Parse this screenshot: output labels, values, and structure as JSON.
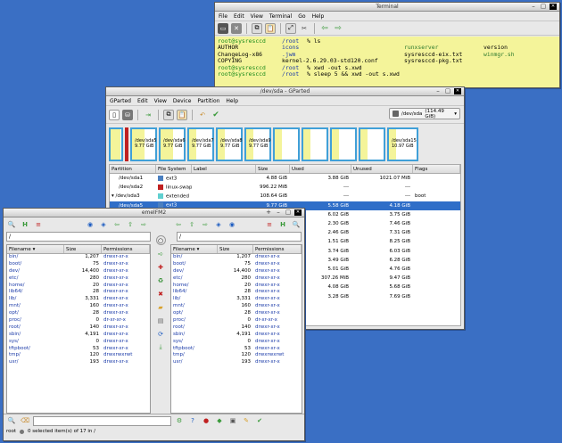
{
  "terminal": {
    "title": "Terminal",
    "menu": [
      "File",
      "Edit",
      "View",
      "Terminal",
      "Go",
      "Help"
    ],
    "lines": [
      {
        "prompt": "root@sysresccd",
        "path": "/root",
        "cmd": "% ls"
      },
      {
        "cols": [
          {
            "t": "AUTHOR",
            "c": ""
          },
          {
            "t": "icons",
            "c": "blue"
          },
          {
            "t": "runxserver",
            "c": "dkgreen"
          },
          {
            "t": "version",
            "c": ""
          }
        ]
      },
      {
        "cols": [
          {
            "t": "ChangeLog-x86",
            "c": ""
          },
          {
            "t": ".jwm",
            "c": "blue"
          },
          {
            "t": "sysresccd-eix.txt",
            "c": ""
          },
          {
            "t": "winmgr.sh",
            "c": "dkgreen"
          }
        ]
      },
      {
        "cols": [
          {
            "t": "COPYING",
            "c": ""
          },
          {
            "t": "kernel-2.6.29.03-std120.conf",
            "c": ""
          },
          {
            "t": "sysresccd-pkg.txt",
            "c": ""
          },
          {
            "t": "",
            "c": ""
          }
        ]
      },
      {
        "prompt": "root@sysresccd",
        "path": "/root",
        "cmd": "% xwd -out s.xwd"
      },
      {
        "prompt": "root@sysresccd",
        "path": "/root",
        "cmd": "% sleep 5 && xwd -out s.xwd"
      }
    ]
  },
  "gparted": {
    "title": "/dev/sda - GParted",
    "menu": [
      "GParted",
      "Edit",
      "View",
      "Device",
      "Partition",
      "Help"
    ],
    "device": "/dev/sda",
    "device_size": "(114.49 GiB)",
    "map": [
      {
        "name": "",
        "size": "",
        "fill": 0.95,
        "w": 16,
        "border": "#40a0d8"
      },
      {
        "name": "",
        "size": "",
        "fill": 0,
        "w": 4,
        "border": "#c02020"
      },
      {
        "name": "/dev/sda5",
        "size": "9.77 GiB",
        "fill": 0.55,
        "w": 30,
        "border": "#40a0d8"
      },
      {
        "name": "/dev/sda6",
        "size": "9.77 GiB",
        "fill": 0.55,
        "w": 30,
        "border": "#40a0d8"
      },
      {
        "name": "/dev/sda7",
        "size": "9.77 GiB",
        "fill": 0.3,
        "w": 30,
        "border": "#40a0d8"
      },
      {
        "name": "/dev/sda8",
        "size": "9.77 GiB",
        "fill": 0.3,
        "w": 30,
        "border": "#40a0d8"
      },
      {
        "name": "/dev/sda9",
        "size": "9.77 GiB",
        "fill": 0.3,
        "w": 30,
        "border": "#40a0d8"
      },
      {
        "name": "",
        "size": "",
        "fill": 0.3,
        "w": 30,
        "border": "#40a0d8"
      },
      {
        "name": "",
        "size": "",
        "fill": 0.3,
        "w": 30,
        "border": "#40a0d8"
      },
      {
        "name": "",
        "size": "",
        "fill": 0.3,
        "w": 30,
        "border": "#40a0d8"
      },
      {
        "name": "",
        "size": "",
        "fill": 0.3,
        "w": 30,
        "border": "#40a0d8"
      },
      {
        "name": "/dev/sda15",
        "size": "10.97 GiB",
        "fill": 0.25,
        "w": 35,
        "border": "#40a0d8"
      }
    ],
    "columns": [
      "Partition",
      "File System",
      "Label",
      "Size",
      "Used",
      "Unused",
      "Flags"
    ],
    "rows": [
      {
        "part": "/dev/sda1",
        "fs": "ext3",
        "color": "#4a7fc0",
        "size": "4.88 GiB",
        "used": "3.88 GiB",
        "unused": "1021.07 MiB",
        "flags": "",
        "indent": false,
        "selected": false
      },
      {
        "part": "/dev/sda2",
        "fs": "linux-swap",
        "color": "#c02020",
        "size": "996.22 MiB",
        "used": "---",
        "unused": "---",
        "flags": "",
        "indent": false,
        "selected": false
      },
      {
        "part": "/dev/sda3",
        "fs": "extended",
        "color": "#60d0d0",
        "size": "108.64 GiB",
        "used": "---",
        "unused": "---",
        "flags": "boot",
        "indent": false,
        "selected": false,
        "expander": true
      },
      {
        "part": "/dev/sda5",
        "fs": "ext3",
        "color": "#4a7fc0",
        "size": "9.77 GiB",
        "used": "5.58 GiB",
        "unused": "4.18 GiB",
        "flags": "",
        "indent": true,
        "selected": true
      },
      {
        "part": "",
        "fs": "",
        "color": "",
        "size": "",
        "used": "6.02 GiB",
        "unused": "3.75 GiB",
        "flags": "",
        "indent": true,
        "selected": false
      },
      {
        "part": "",
        "fs": "",
        "color": "",
        "size": "",
        "used": "2.30 GiB",
        "unused": "7.46 GiB",
        "flags": "",
        "indent": true,
        "selected": false
      },
      {
        "part": "",
        "fs": "",
        "color": "",
        "size": "",
        "used": "2.46 GiB",
        "unused": "7.31 GiB",
        "flags": "",
        "indent": true,
        "selected": false
      },
      {
        "part": "",
        "fs": "",
        "color": "",
        "size": "",
        "used": "1.51 GiB",
        "unused": "8.25 GiB",
        "flags": "",
        "indent": true,
        "selected": false
      },
      {
        "part": "",
        "fs": "",
        "color": "",
        "size": "",
        "used": "3.74 GiB",
        "unused": "6.03 GiB",
        "flags": "",
        "indent": true,
        "selected": false
      },
      {
        "part": "",
        "fs": "",
        "color": "",
        "size": "",
        "used": "3.49 GiB",
        "unused": "6.28 GiB",
        "flags": "",
        "indent": true,
        "selected": false
      },
      {
        "part": "",
        "fs": "",
        "color": "",
        "size": "",
        "used": "5.01 GiB",
        "unused": "4.76 GiB",
        "flags": "",
        "indent": true,
        "selected": false
      },
      {
        "part": "",
        "fs": "",
        "color": "",
        "size": "",
        "used": "307.26 MiB",
        "unused": "9.47 GiB",
        "flags": "",
        "indent": true,
        "selected": false
      },
      {
        "part": "",
        "fs": "",
        "color": "",
        "size": "",
        "used": "4.08 GiB",
        "unused": "5.68 GiB",
        "flags": "",
        "indent": true,
        "selected": false
      },
      {
        "part": "",
        "fs": "",
        "color": "",
        "size": "",
        "used": "3.28 GiB",
        "unused": "7.69 GiB",
        "flags": "",
        "indent": true,
        "selected": false
      }
    ]
  },
  "emelfm": {
    "title": "emelFM2",
    "left_path": "/",
    "right_path": "/",
    "columns": [
      "Filename",
      "Size",
      "Permissions"
    ],
    "files": [
      {
        "name": "bin/",
        "size": "1,207",
        "perm": "drwxr-xr-x"
      },
      {
        "name": "boot/",
        "size": "75",
        "perm": "drwxr-xr-x"
      },
      {
        "name": "dev/",
        "size": "14,400",
        "perm": "drwxr-xr-x"
      },
      {
        "name": "etc/",
        "size": "280",
        "perm": "drwxr-xr-x"
      },
      {
        "name": "home/",
        "size": "20",
        "perm": "drwxr-xr-x"
      },
      {
        "name": "lib64/",
        "size": "28",
        "perm": "drwxr-xr-x"
      },
      {
        "name": "lib/",
        "size": "3,331",
        "perm": "drwxr-xr-x"
      },
      {
        "name": "mnt/",
        "size": "160",
        "perm": "drwxr-xr-x"
      },
      {
        "name": "opt/",
        "size": "28",
        "perm": "drwxr-xr-x"
      },
      {
        "name": "proc/",
        "size": "0",
        "perm": "dr-xr-xr-x"
      },
      {
        "name": "root/",
        "size": "140",
        "perm": "drwxr-xr-x"
      },
      {
        "name": "sbin/",
        "size": "4,191",
        "perm": "drwxr-xr-x"
      },
      {
        "name": "sys/",
        "size": "0",
        "perm": "drwxr-xr-x"
      },
      {
        "name": "tftpboot/",
        "size": "53",
        "perm": "drwxr-xr-x"
      },
      {
        "name": "tmp/",
        "size": "120",
        "perm": "drwxrwxrwt"
      },
      {
        "name": "usr/",
        "size": "193",
        "perm": "drwxr-xr-x"
      }
    ],
    "status_user": "root",
    "status_text": "0 selected item(s) of 17 in /"
  }
}
